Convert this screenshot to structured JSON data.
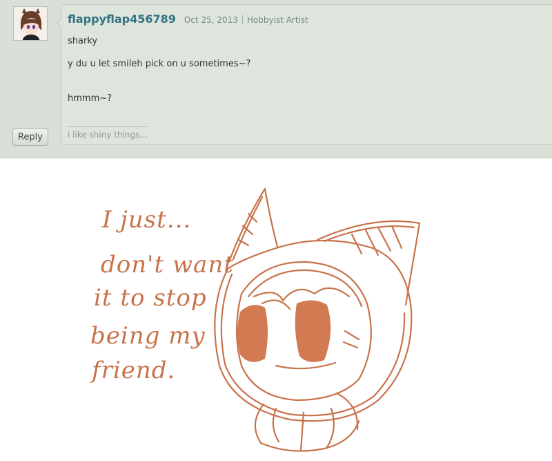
{
  "comment": {
    "username": "flappyflap456789",
    "date": "Oct 25, 2013",
    "member_type": "Hobbyist Artist",
    "lines": [
      "sharky",
      "y du u let smileh pick on u sometimes~?",
      "hmmm~?"
    ],
    "signature": "i like shiny things...",
    "reply_label": "Reply"
  },
  "drawing": {
    "text_lines": [
      "I just...",
      "don't want",
      "it to stop",
      "being my",
      "friend."
    ],
    "ink_color": "#c8724a"
  }
}
